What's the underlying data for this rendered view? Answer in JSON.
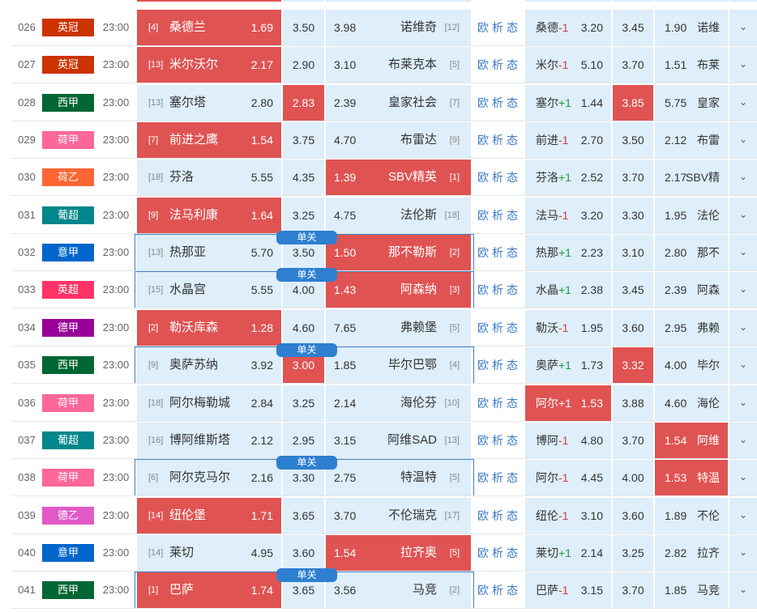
{
  "single_label": "单关",
  "more_icon": "chevron-down-icon",
  "colors": {
    "highlight": "#e05353",
    "cell_bg": "#deeefa",
    "single_border": "#3d7fc2",
    "link": "#3a7cc8",
    "handicap_negative": "#d93a3a",
    "handicap_positive": "#1f9a3f"
  },
  "league_colors": {
    "英冠": "#cc3300",
    "西甲": "#006633",
    "荷甲": "#ff6699",
    "荷乙": "#ff6633",
    "葡超": "#00868b",
    "意甲": "#0066cc",
    "英超": "#ff3366",
    "德甲": "#990099",
    "德乙": "#e05ac8"
  },
  "matches": [
    {
      "no": "026",
      "league": "英冠",
      "time": "23:00",
      "home_rank": "[4]",
      "home": "桑德兰",
      "home_odds": "1.69",
      "draw": "3.50",
      "away_odds": "3.98",
      "away": "诺维奇",
      "away_rank": "[12]",
      "hi": "home",
      "single": false,
      "links": "欧析态",
      "hd_name": "桑德",
      "hd_spread": "-1",
      "hd_home": "3.20",
      "hd_draw": "3.45",
      "hd_away_odds": "1.90",
      "hd_away": "诺维",
      "hd_hi": ""
    },
    {
      "no": "027",
      "league": "英冠",
      "time": "23:00",
      "home_rank": "[13]",
      "home": "米尔沃尔",
      "home_odds": "2.17",
      "draw": "2.90",
      "away_odds": "3.10",
      "away": "布莱克本",
      "away_rank": "[5]",
      "hi": "home",
      "single": false,
      "links": "欧析态",
      "hd_name": "米尔",
      "hd_spread": "-1",
      "hd_home": "5.10",
      "hd_draw": "3.70",
      "hd_away_odds": "1.51",
      "hd_away": "布莱",
      "hd_hi": ""
    },
    {
      "no": "028",
      "league": "西甲",
      "time": "23:00",
      "home_rank": "[13]",
      "home": "塞尔塔",
      "home_odds": "2.80",
      "draw": "2.83",
      "away_odds": "2.39",
      "away": "皇家社会",
      "away_rank": "[7]",
      "hi": "draw",
      "single": false,
      "links": "欧析态",
      "hd_name": "塞尔",
      "hd_spread": "+1",
      "hd_home": "1.44",
      "hd_draw": "3.85",
      "hd_away_odds": "5.75",
      "hd_away": "皇家",
      "hd_hi": "draw"
    },
    {
      "no": "029",
      "league": "荷甲",
      "time": "23:00",
      "home_rank": "[7]",
      "home": "前进之鹰",
      "home_odds": "1.54",
      "draw": "3.75",
      "away_odds": "4.70",
      "away": "布雷达",
      "away_rank": "[9]",
      "hi": "home",
      "single": false,
      "links": "欧析态",
      "hd_name": "前进",
      "hd_spread": "-1",
      "hd_home": "2.70",
      "hd_draw": "3.50",
      "hd_away_odds": "2.12",
      "hd_away": "布雷",
      "hd_hi": ""
    },
    {
      "no": "030",
      "league": "荷乙",
      "time": "23:00",
      "home_rank": "[18]",
      "home": "芬洛",
      "home_odds": "5.55",
      "draw": "4.35",
      "away_odds": "1.39",
      "away": "SBV精英",
      "away_rank": "[1]",
      "hi": "away",
      "single": false,
      "links": "欧析态",
      "hd_name": "芬洛",
      "hd_spread": "+1",
      "hd_home": "2.52",
      "hd_draw": "3.70",
      "hd_away_odds": "2.17",
      "hd_away": "SBV精",
      "hd_hi": ""
    },
    {
      "no": "031",
      "league": "葡超",
      "time": "23:00",
      "home_rank": "[9]",
      "home": "法马利康",
      "home_odds": "1.64",
      "draw": "3.25",
      "away_odds": "4.75",
      "away": "法伦斯",
      "away_rank": "[18]",
      "hi": "home",
      "single": false,
      "links": "欧析态",
      "hd_name": "法马",
      "hd_spread": "-1",
      "hd_home": "3.20",
      "hd_draw": "3.30",
      "hd_away_odds": "1.95",
      "hd_away": "法伦",
      "hd_hi": ""
    },
    {
      "no": "032",
      "league": "意甲",
      "time": "23:00",
      "home_rank": "[13]",
      "home": "热那亚",
      "home_odds": "5.70",
      "draw": "3.50",
      "away_odds": "1.50",
      "away": "那不勒斯",
      "away_rank": "[2]",
      "hi": "away",
      "single": true,
      "links": "欧析态",
      "hd_name": "热那",
      "hd_spread": "+1",
      "hd_home": "2.23",
      "hd_draw": "3.10",
      "hd_away_odds": "2.80",
      "hd_away": "那不",
      "hd_hi": ""
    },
    {
      "no": "033",
      "league": "英超",
      "time": "23:00",
      "home_rank": "[15]",
      "home": "水晶宫",
      "home_odds": "5.55",
      "draw": "4.00",
      "away_odds": "1.43",
      "away": "阿森纳",
      "away_rank": "[3]",
      "hi": "away",
      "single": true,
      "links": "欧析态",
      "hd_name": "水晶",
      "hd_spread": "+1",
      "hd_home": "2.38",
      "hd_draw": "3.45",
      "hd_away_odds": "2.39",
      "hd_away": "阿森",
      "hd_hi": ""
    },
    {
      "no": "034",
      "league": "德甲",
      "time": "23:00",
      "home_rank": "[2]",
      "home": "勒沃库森",
      "home_odds": "1.28",
      "draw": "4.60",
      "away_odds": "7.65",
      "away": "弗赖堡",
      "away_rank": "[5]",
      "hi": "home",
      "single": false,
      "links": "欧析态",
      "hd_name": "勒沃",
      "hd_spread": "-1",
      "hd_home": "1.95",
      "hd_draw": "3.60",
      "hd_away_odds": "2.95",
      "hd_away": "弗赖",
      "hd_hi": ""
    },
    {
      "no": "035",
      "league": "西甲",
      "time": "23:00",
      "home_rank": "[9]",
      "home": "奥萨苏纳",
      "home_odds": "3.92",
      "draw": "3.00",
      "away_odds": "1.85",
      "away": "毕尔巴鄂",
      "away_rank": "[4]",
      "hi": "draw",
      "single": true,
      "links": "欧析态",
      "hd_name": "奥萨",
      "hd_spread": "+1",
      "hd_home": "1.73",
      "hd_draw": "3.32",
      "hd_away_odds": "4.00",
      "hd_away": "毕尔",
      "hd_hi": "draw"
    },
    {
      "no": "036",
      "league": "荷甲",
      "time": "23:00",
      "home_rank": "[18]",
      "home": "阿尔梅勒城",
      "home_odds": "2.84",
      "draw": "3.25",
      "away_odds": "2.14",
      "away": "海伦芬",
      "away_rank": "[10]",
      "hi": "",
      "single": false,
      "links": "欧析态",
      "hd_name": "阿尔",
      "hd_spread": "+1",
      "hd_home": "1.53",
      "hd_draw": "3.88",
      "hd_away_odds": "4.60",
      "hd_away": "海伦",
      "hd_hi": "home"
    },
    {
      "no": "037",
      "league": "葡超",
      "time": "23:00",
      "home_rank": "[16]",
      "home": "博阿维斯塔",
      "home_odds": "2.12",
      "draw": "2.95",
      "away_odds": "3.15",
      "away": "阿维SAD",
      "away_rank": "[13]",
      "hi": "",
      "single": false,
      "links": "欧析态",
      "hd_name": "博阿",
      "hd_spread": "-1",
      "hd_home": "4.80",
      "hd_draw": "3.70",
      "hd_away_odds": "1.54",
      "hd_away": "阿维",
      "hd_hi": "away"
    },
    {
      "no": "038",
      "league": "荷甲",
      "time": "23:00",
      "home_rank": "[6]",
      "home": "阿尔克马尔",
      "home_odds": "2.16",
      "draw": "3.30",
      "away_odds": "2.75",
      "away": "特温特",
      "away_rank": "[5]",
      "hi": "",
      "single": true,
      "links": "欧析态",
      "hd_name": "阿尔",
      "hd_spread": "-1",
      "hd_home": "4.45",
      "hd_draw": "4.00",
      "hd_away_odds": "1.53",
      "hd_away": "特温",
      "hd_hi": "away"
    },
    {
      "no": "039",
      "league": "德乙",
      "time": "23:00",
      "home_rank": "[14]",
      "home": "纽伦堡",
      "home_odds": "1.71",
      "draw": "3.65",
      "away_odds": "3.70",
      "away": "不伦瑞克",
      "away_rank": "[17]",
      "hi": "home",
      "single": false,
      "links": "欧析态",
      "hd_name": "纽伦",
      "hd_spread": "-1",
      "hd_home": "3.10",
      "hd_draw": "3.60",
      "hd_away_odds": "1.89",
      "hd_away": "不伦",
      "hd_hi": ""
    },
    {
      "no": "040",
      "league": "意甲",
      "time": "23:00",
      "home_rank": "[14]",
      "home": "莱切",
      "home_odds": "4.95",
      "draw": "3.60",
      "away_odds": "1.54",
      "away": "拉齐奥",
      "away_rank": "[5]",
      "hi": "away",
      "single": false,
      "links": "欧析态",
      "hd_name": "莱切",
      "hd_spread": "+1",
      "hd_home": "2.14",
      "hd_draw": "3.25",
      "hd_away_odds": "2.82",
      "hd_away": "拉齐",
      "hd_hi": ""
    },
    {
      "no": "041",
      "league": "西甲",
      "time": "23:00",
      "home_rank": "[1]",
      "home": "巴萨",
      "home_odds": "1.74",
      "draw": "3.65",
      "away_odds": "3.56",
      "away": "马竞",
      "away_rank": "[2]",
      "hi": "home",
      "single": true,
      "links": "欧析态",
      "hd_name": "巴萨",
      "hd_spread": "-1",
      "hd_home": "3.15",
      "hd_draw": "3.70",
      "hd_away_odds": "1.85",
      "hd_away": "马竞",
      "hd_hi": ""
    }
  ]
}
